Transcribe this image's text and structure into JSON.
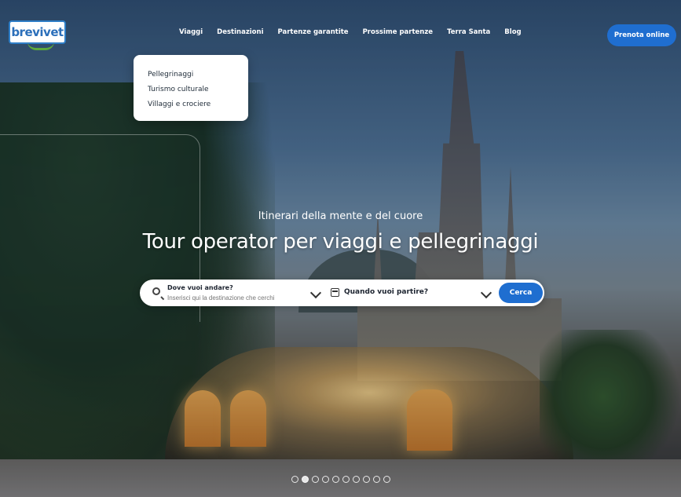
{
  "header": {
    "logo_text": "brevivet",
    "nav": [
      "Viaggi",
      "Destinazioni",
      "Partenze garantite",
      "Prossime partenze",
      "Terra Santa",
      "Blog"
    ],
    "cta_label": "Prenota online"
  },
  "dropdown": {
    "items": [
      "Pellegrinaggi",
      "Turismo culturale",
      "Villaggi e crociere"
    ]
  },
  "hero": {
    "subtitle": "Itinerari della mente e del cuore",
    "title": "Tour operator per viaggi e pellegrinaggi"
  },
  "search": {
    "destination_label": "Dove vuoi andare?",
    "destination_placeholder": "Inserisci qui la destinazione che cerchi",
    "date_label": "Quando vuoi partire?",
    "button_label": "Cerca"
  },
  "carousel": {
    "count": 10,
    "active_index": 1
  },
  "colors": {
    "accent": "#1f6ed0"
  },
  "icons": {
    "search": "search-icon",
    "calendar": "calendar-icon",
    "chevron": "chevron-down-icon"
  }
}
